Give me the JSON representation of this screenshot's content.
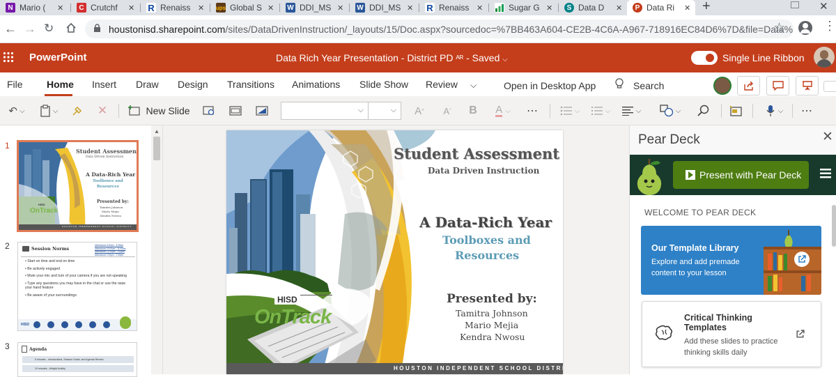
{
  "browser": {
    "tabs": [
      {
        "label": "Mario (",
        "icon": "onenote-icon",
        "color": "#7719aa"
      },
      {
        "label": "Crutchf",
        "icon": "crutchfield-icon",
        "color": "#d32f2f"
      },
      {
        "label": "Renaiss",
        "icon": "renaissance-icon",
        "color": "#0d47a1"
      },
      {
        "label": "Global S",
        "icon": "ups-icon",
        "color": "#5d3a1a"
      },
      {
        "label": "DDI_MS",
        "icon": "word-icon",
        "color": "#2b579a"
      },
      {
        "label": "DDI_MS",
        "icon": "word-icon",
        "color": "#2b579a"
      },
      {
        "label": "Renaiss",
        "icon": "renaissance-icon",
        "color": "#0d47a1"
      },
      {
        "label": "Sugar G",
        "icon": "sheets-icon",
        "color": "#1e8e3e"
      },
      {
        "label": "Data D",
        "icon": "sharepoint-icon",
        "color": "#038387"
      },
      {
        "label": "Data Ri",
        "icon": "powerpoint-icon",
        "color": "#c43e1c"
      }
    ],
    "url_domain": "houstonisd.sharepoint.com",
    "url_path": "/sites/DataDrivenInstruction/_layouts/15/Doc.aspx?sourcedoc=%7BB463A604-CE2B-4C6A-A967-718916EC84D6%7D&file=Data%2..."
  },
  "app": {
    "name": "PowerPoint",
    "doc_title": "Data Rich Year Presentation - District PD",
    "saved": "Saved",
    "single_line_ribbon": "Single Line Ribbon",
    "accent_color": "#c43e1c"
  },
  "ribbon": {
    "tabs": [
      "File",
      "Home",
      "Insert",
      "Draw",
      "Design",
      "Transitions",
      "Animations",
      "Slide Show",
      "Review"
    ],
    "open_desktop": "Open in Desktop App",
    "search": "Search",
    "new_slide": "New Slide",
    "bold": "B"
  },
  "thumbs": {
    "nums": [
      "1",
      "2",
      "3"
    ],
    "s1": {
      "title": "Student Assessment",
      "sub": "Data Driven Instruction",
      "h": "A Data-Rich Year",
      "t1": "Toolboxes and",
      "t2": "Resources",
      "pres": "Presented by:",
      "n1": "Tamitra Johnson",
      "n2": "Mario Mejia",
      "n3": "Kendra Nwosu",
      "hisd": "HISD",
      "ontrack": "OnTrack",
      "footer": "HOUSTON INDEPENDENT SCHOOL DISTRICT"
    },
    "s2": {
      "title": "Session Norms",
      "att": [
        "Attendance 8:30am - 8:35am",
        "Attendance 10:00am - 11:00am",
        "Attendance 12:30pm - 1:00pm",
        "Attendance 2:00pm - 2:30pm"
      ],
      "bullets": [
        "Start on time and end on time",
        "Be actively engaged",
        "Mute your mic and turn of your camera if you are not speaking",
        "Type any questions you may have in the chat or use the raise your hand feature",
        "Be aware of your surroundings"
      ],
      "footer": "HISD"
    },
    "s3": {
      "title": "Agenda",
      "rows": [
        "5 minutes - Introductions, Session Goals, and Agenda Review",
        "10 minutes - Airtight Activity"
      ]
    }
  },
  "slide": {
    "title": "Student Assessment",
    "subtitle": "Data Driven Instruction",
    "heading": "A Data-Rich Year",
    "line1": "Toolboxes and",
    "line2": "Resources",
    "presented": "Presented by:",
    "name1": "Tamitra Johnson",
    "name2": "Mario Mejia",
    "name3": "Kendra Nwosu",
    "hisd": "HISD",
    "ontrack": "OnTrack",
    "footer": "HOUSTON INDEPENDENT SCHOOL DISTRICT"
  },
  "peardeck": {
    "title": "Pear Deck",
    "present": "Present with Pear Deck",
    "welcome": "WELCOME TO PEAR DECK",
    "card1_title": "Our Template Library",
    "card1_text": "Explore and add premade content to your lesson",
    "card2_title": "Critical Thinking Templates",
    "card2_text": "Add these slides to practice thinking skills daily",
    "green": "#4e7d12",
    "blue": "#2e81c7"
  }
}
